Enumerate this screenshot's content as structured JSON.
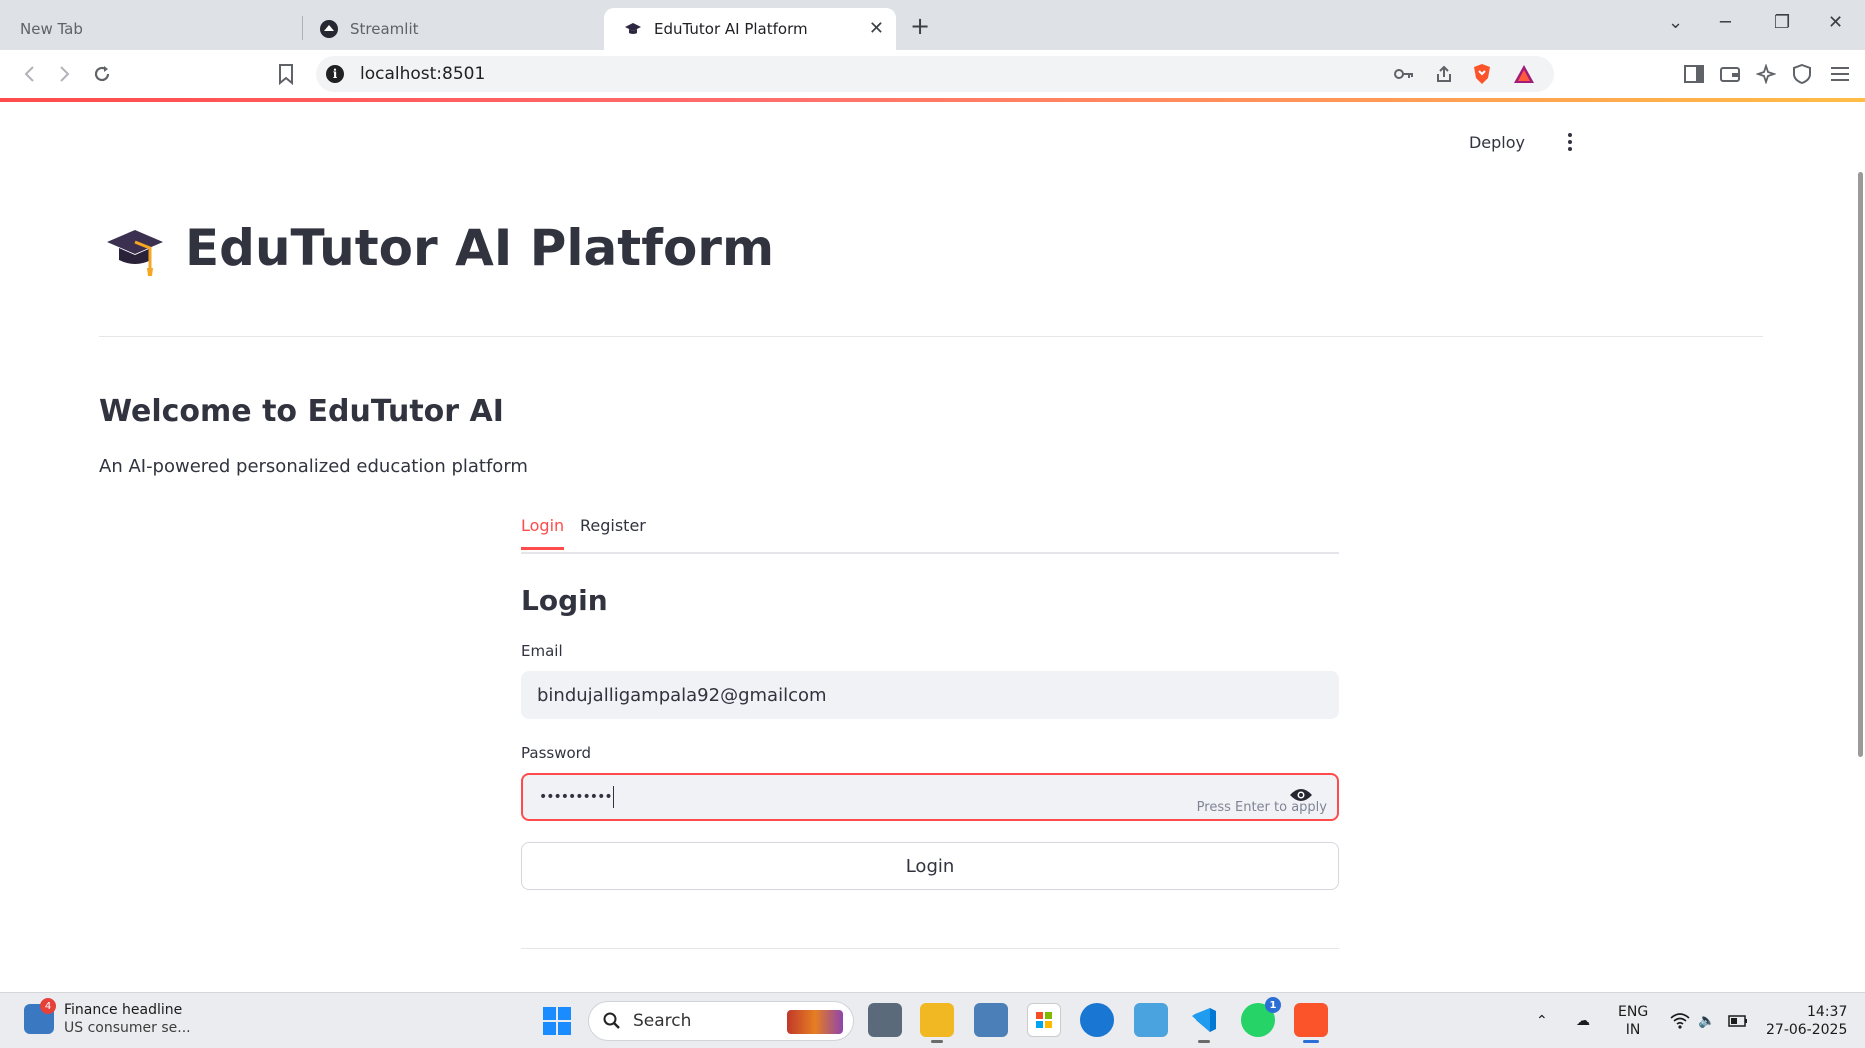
{
  "browser": {
    "tabs": [
      {
        "label": "New Tab",
        "active": false
      },
      {
        "label": "Streamlit",
        "active": false
      },
      {
        "label": "EduTutor AI Platform",
        "active": true
      }
    ],
    "url": "localhost:8501"
  },
  "app": {
    "deploy_label": "Deploy",
    "title": "EduTutor AI Platform",
    "welcome": "Welcome to EduTutor AI",
    "subtitle": "An AI-powered personalized education platform",
    "tabs": [
      {
        "label": "Login",
        "active": true
      },
      {
        "label": "Register",
        "active": false
      }
    ],
    "form": {
      "heading": "Login",
      "email_label": "Email",
      "email_value": "bindujalligampala92@gmailcom",
      "password_label": "Password",
      "password_value": "••••••••••",
      "password_hint": "Press Enter to apply",
      "submit_label": "Login"
    }
  },
  "taskbar": {
    "news_title": "Finance headline",
    "news_sub": "US consumer se...",
    "news_badge": "4",
    "search_label": "Search",
    "whatsapp_badge": "1",
    "lang_top": "ENG",
    "lang_bottom": "IN",
    "time": "14:37",
    "date": "27-06-2025"
  },
  "colors": {
    "accent": "#ff4b4b",
    "input_bg": "#f0f2f6",
    "text": "#31333f"
  }
}
